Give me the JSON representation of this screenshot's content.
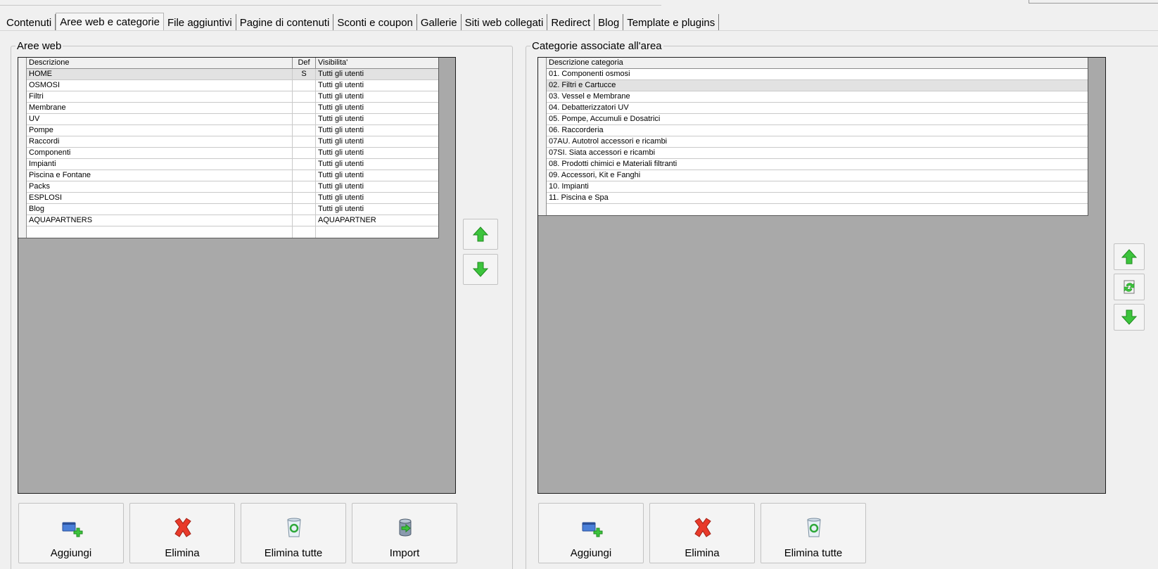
{
  "tabs": [
    {
      "label": "Contenuti",
      "active": false
    },
    {
      "label": "Aree web e categorie",
      "active": true
    },
    {
      "label": "File aggiuntivi",
      "active": false
    },
    {
      "label": "Pagine di contenuti",
      "active": false
    },
    {
      "label": "Sconti e coupon",
      "active": false
    },
    {
      "label": "Gallerie",
      "active": false
    },
    {
      "label": "Siti web collegati",
      "active": false
    },
    {
      "label": "Redirect",
      "active": false
    },
    {
      "label": "Blog",
      "active": false
    },
    {
      "label": "Template e plugins",
      "active": false
    }
  ],
  "left_panel": {
    "title": "Aree web",
    "columns": {
      "descrizione": "Descrizione",
      "def": "Def",
      "visibilita": "Visibilita'"
    },
    "rows": [
      {
        "descrizione": "HOME",
        "def": "S",
        "visibilita": "Tutti gli utenti",
        "selected": true
      },
      {
        "descrizione": "OSMOSI",
        "def": "",
        "visibilita": "Tutti gli utenti"
      },
      {
        "descrizione": "Filtri",
        "def": "",
        "visibilita": "Tutti gli utenti"
      },
      {
        "descrizione": "Membrane",
        "def": "",
        "visibilita": "Tutti gli utenti"
      },
      {
        "descrizione": "UV",
        "def": "",
        "visibilita": "Tutti gli utenti"
      },
      {
        "descrizione": "Pompe",
        "def": "",
        "visibilita": "Tutti gli utenti"
      },
      {
        "descrizione": "Raccordi",
        "def": "",
        "visibilita": "Tutti gli utenti"
      },
      {
        "descrizione": "Componenti",
        "def": "",
        "visibilita": "Tutti gli utenti"
      },
      {
        "descrizione": "Impianti",
        "def": "",
        "visibilita": "Tutti gli utenti"
      },
      {
        "descrizione": "Piscina e Fontane",
        "def": "",
        "visibilita": "Tutti gli utenti"
      },
      {
        "descrizione": "Packs",
        "def": "",
        "visibilita": "Tutti gli utenti"
      },
      {
        "descrizione": "ESPLOSI",
        "def": "",
        "visibilita": "Tutti gli utenti"
      },
      {
        "descrizione": "Blog",
        "def": "",
        "visibilita": "Tutti gli utenti"
      },
      {
        "descrizione": "AQUAPARTNERS",
        "def": "",
        "visibilita": "AQUAPARTNER"
      }
    ],
    "buttons": {
      "add": "Aggiungi",
      "delete": "Elimina",
      "delete_all": "Elimina tutte",
      "import": "Import"
    }
  },
  "right_panel": {
    "title": "Categorie associate all'area",
    "columns": {
      "descrizione": "Descrizione categoria"
    },
    "rows": [
      {
        "descrizione": "01. Componenti osmosi"
      },
      {
        "descrizione": "02. Filtri e Cartucce",
        "selected": true
      },
      {
        "descrizione": "03. Vessel e Membrane"
      },
      {
        "descrizione": "04. Debatterizzatori UV"
      },
      {
        "descrizione": "05. Pompe, Accumuli e Dosatrici"
      },
      {
        "descrizione": "06. Raccorderia"
      },
      {
        "descrizione": "07AU. Autotrol accessori e ricambi"
      },
      {
        "descrizione": "07SI. Siata accessori e ricambi"
      },
      {
        "descrizione": "08. Prodotti chimici e Materiali filtranti"
      },
      {
        "descrizione": "09. Accessori, Kit e Fanghi"
      },
      {
        "descrizione": "10. Impianti"
      },
      {
        "descrizione": "11. Piscina e Spa"
      }
    ],
    "buttons": {
      "add": "Aggiungi",
      "delete": "Elimina",
      "delete_all": "Elimina tutte"
    }
  },
  "icons": {
    "arrow_up": "arrow-up-icon",
    "arrow_down": "arrow-down-icon",
    "refresh": "refresh-icon",
    "add": "add-window-icon",
    "delete": "red-x-icon",
    "delete_all": "recycle-bin-icon",
    "import": "database-import-icon"
  },
  "colors": {
    "grid_background": "#a9a9a9",
    "arrow_green": "#3cc43c",
    "delete_red": "#e83a2a",
    "selected_row": "#e2e2e2"
  }
}
